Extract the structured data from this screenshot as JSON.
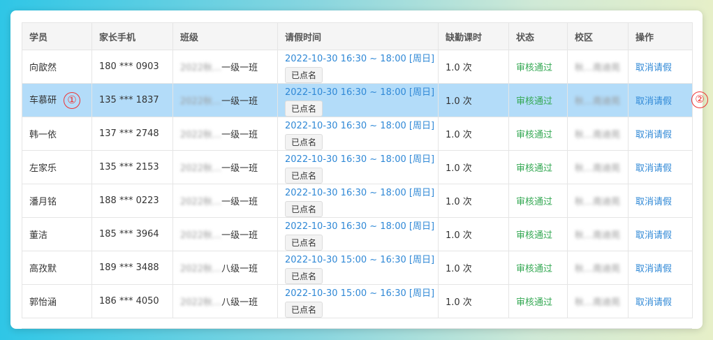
{
  "columns": [
    "学员",
    "家长手机",
    "班级",
    "请假时间",
    "缺勤课时",
    "状态",
    "校区",
    "操作"
  ],
  "rows": [
    {
      "student": "向歆然",
      "phone": "180 *** 0903",
      "class_prefix": "2022秋…",
      "class_suffix": "一级一班",
      "time": "2022-10-30 16:30 ~ 18:00 [周日]",
      "tag": "已点名",
      "hours": "1.0 次",
      "status": "审核通过",
      "campus": "秋…南迪苑",
      "action": "取消请假"
    },
    {
      "student": "车慕研",
      "phone": "135 *** 1837",
      "class_prefix": "2022秋…",
      "class_suffix": "一级一班",
      "time": "2022-10-30 16:30 ~ 18:00 [周日]",
      "tag": "已点名",
      "hours": "1.0 次",
      "status": "审核通过",
      "campus": "秋…南迪苑",
      "action": "取消请假"
    },
    {
      "student": "韩一依",
      "phone": "137 *** 2748",
      "class_prefix": "2022秋…",
      "class_suffix": "一级一班",
      "time": "2022-10-30 16:30 ~ 18:00 [周日]",
      "tag": "已点名",
      "hours": "1.0 次",
      "status": "审核通过",
      "campus": "秋…南迪苑",
      "action": "取消请假"
    },
    {
      "student": "左家乐",
      "phone": "135 *** 2153",
      "class_prefix": "2022秋…",
      "class_suffix": "一级一班",
      "time": "2022-10-30 16:30 ~ 18:00 [周日]",
      "tag": "已点名",
      "hours": "1.0 次",
      "status": "审核通过",
      "campus": "秋…南迪苑",
      "action": "取消请假"
    },
    {
      "student": "潘月铭",
      "phone": "188 *** 0223",
      "class_prefix": "2022秋…",
      "class_suffix": "一级一班",
      "time": "2022-10-30 16:30 ~ 18:00 [周日]",
      "tag": "已点名",
      "hours": "1.0 次",
      "status": "审核通过",
      "campus": "秋…南迪苑",
      "action": "取消请假"
    },
    {
      "student": "董洁",
      "phone": "185 *** 3964",
      "class_prefix": "2022秋…",
      "class_suffix": "一级一班",
      "time": "2022-10-30 16:30 ~ 18:00 [周日]",
      "tag": "已点名",
      "hours": "1.0 次",
      "status": "审核通过",
      "campus": "秋…南迪苑",
      "action": "取消请假"
    },
    {
      "student": "高孜默",
      "phone": "189 *** 3488",
      "class_prefix": "2022秋…",
      "class_suffix": "八级一班",
      "time": "2022-10-30 15:00 ~ 16:30 [周日]",
      "tag": "已点名",
      "hours": "1.0 次",
      "status": "审核通过",
      "campus": "秋…南迪苑",
      "action": "取消请假"
    },
    {
      "student": "郭怡涵",
      "phone": "186 *** 4050",
      "class_prefix": "2022秋…",
      "class_suffix": "八级一班",
      "time": "2022-10-30 15:00 ~ 16:30 [周日]",
      "tag": "已点名",
      "hours": "1.0 次",
      "status": "审核通过",
      "campus": "秋…南迪苑",
      "action": "取消请假"
    }
  ],
  "selected_row": 1,
  "markers": [
    "①",
    "②"
  ],
  "colors": {
    "link": "#2f88d6",
    "success": "#34a853",
    "selected": "#b3dcf9",
    "marker": "#e33333"
  }
}
